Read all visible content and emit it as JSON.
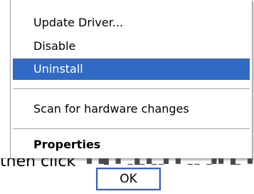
{
  "menu": {
    "items": [
      {
        "label": "Update Driver..."
      },
      {
        "label": "Disable"
      },
      {
        "label": "Uninstall"
      },
      {
        "label": "Scan for hardware changes"
      },
      {
        "label": "Properties"
      }
    ],
    "highlight_color": "#316ac5"
  },
  "background": {
    "text": "then click"
  },
  "dialog": {
    "ok_label": "OK",
    "ok_border_color": "#3a60c8"
  }
}
